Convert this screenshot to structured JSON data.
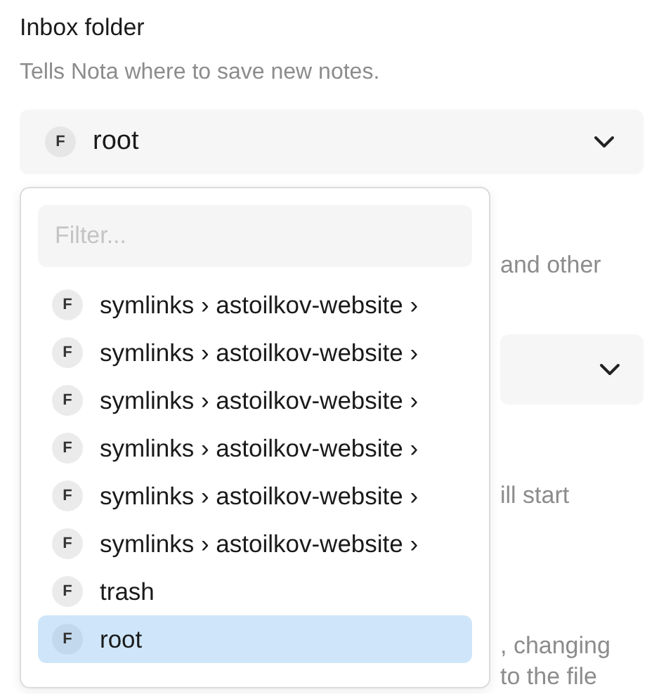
{
  "setting": {
    "title": "Inbox folder",
    "description": "Tells Nota where to save new notes."
  },
  "select": {
    "badge": "F",
    "value": "root",
    "expanded": true
  },
  "popup": {
    "filter": {
      "placeholder": "Filter..."
    },
    "items": [
      {
        "badge": "F",
        "label": "symlinks › astoilkov-website ›",
        "selected": false
      },
      {
        "badge": "F",
        "label": "symlinks › astoilkov-website ›",
        "selected": false
      },
      {
        "badge": "F",
        "label": "symlinks › astoilkov-website ›",
        "selected": false
      },
      {
        "badge": "F",
        "label": "symlinks › astoilkov-website ›",
        "selected": false
      },
      {
        "badge": "F",
        "label": "symlinks › astoilkov-website ›",
        "selected": false
      },
      {
        "badge": "F",
        "label": "symlinks › astoilkov-website ›",
        "selected": false
      },
      {
        "badge": "F",
        "label": "trash",
        "selected": false
      },
      {
        "badge": "F",
        "label": "root",
        "selected": true
      }
    ]
  },
  "background": [
    {
      "kind": "text",
      "text": "and other"
    },
    {
      "kind": "select"
    },
    {
      "kind": "text",
      "text": "ill start"
    },
    {
      "kind": "text",
      "text": ", changing"
    },
    {
      "kind": "text",
      "text": "to the file"
    }
  ]
}
